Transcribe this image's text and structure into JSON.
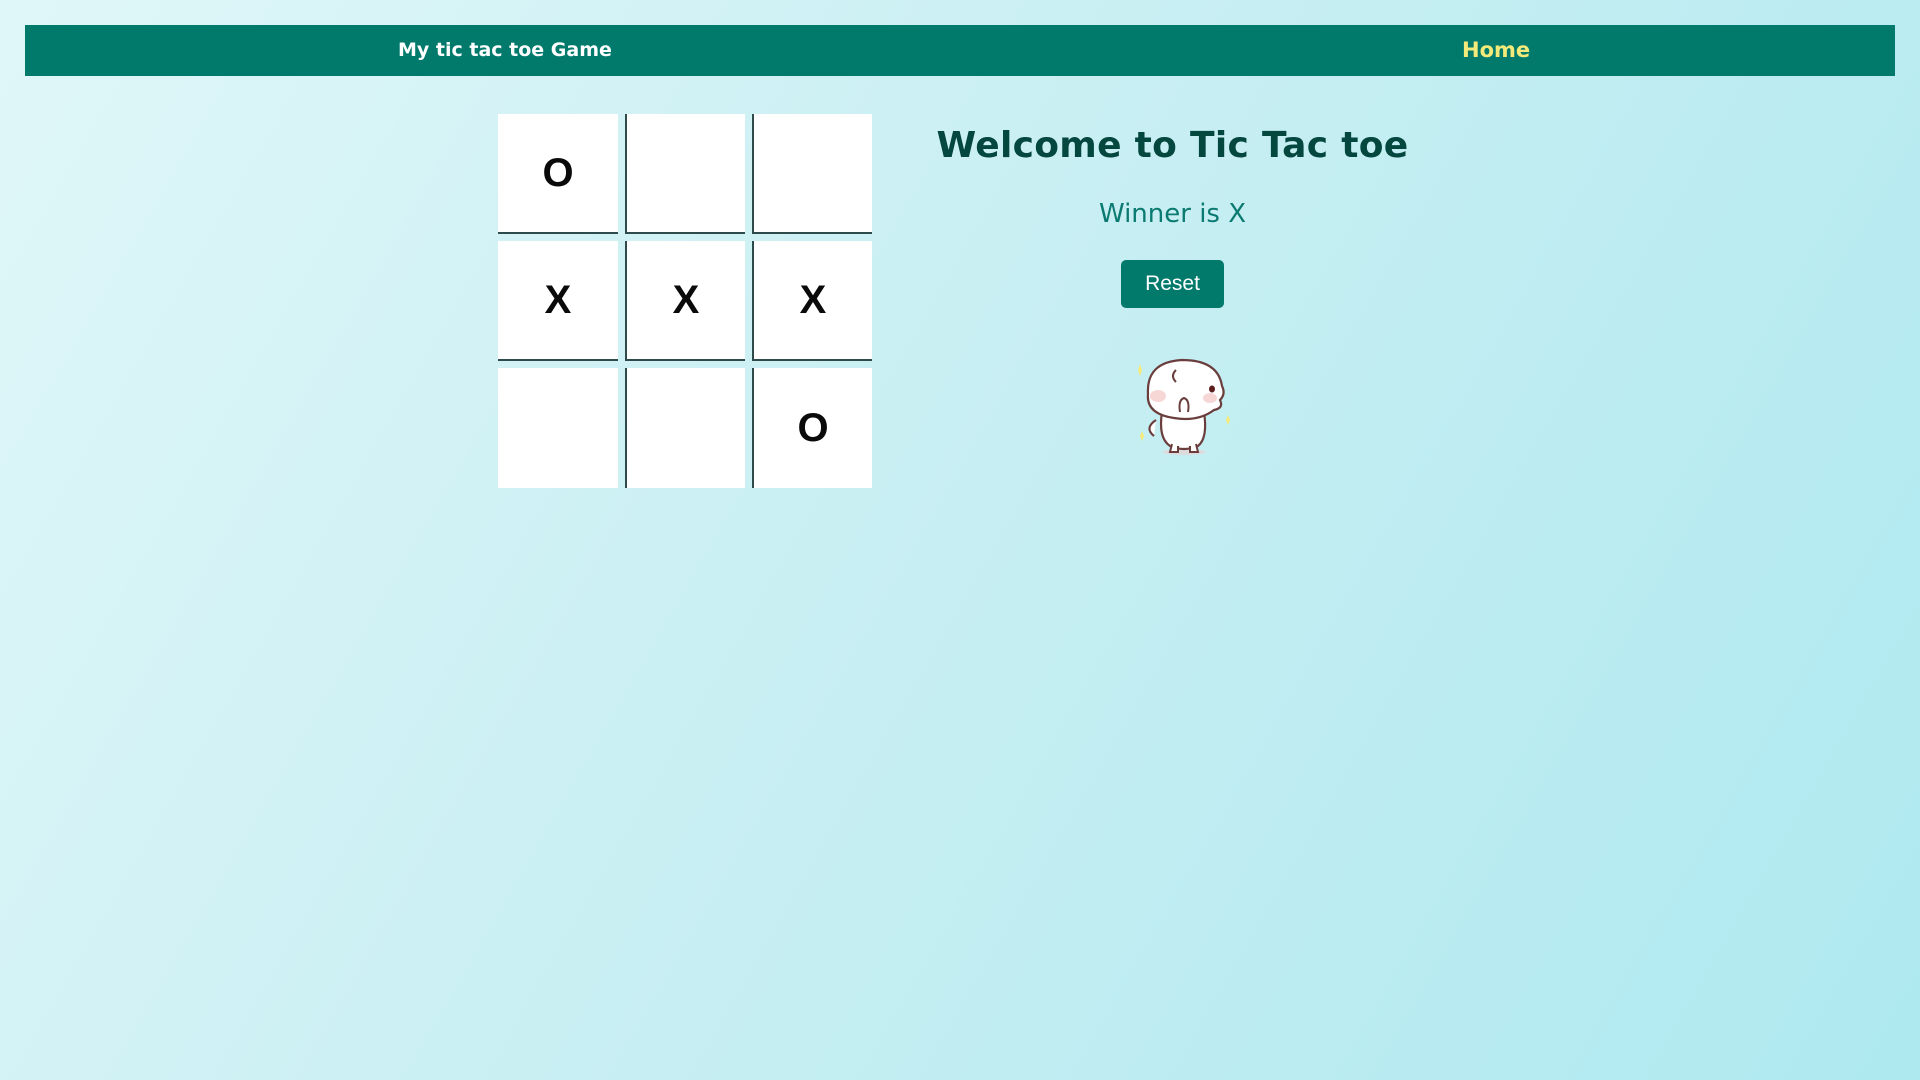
{
  "navbar": {
    "brand": "My tic tac toe Game",
    "home_link": "Home"
  },
  "board": {
    "cells": [
      "O",
      "",
      "",
      "X",
      "X",
      "X",
      "",
      "",
      "O"
    ]
  },
  "panel": {
    "title": "Welcome to Tic Tac toe",
    "status": "Winner is X",
    "reset_label": "Reset"
  },
  "mascot": {
    "icon": "dancing-cat-icon"
  },
  "colors": {
    "nav_background": "#017a6c",
    "home_link": "#f3ea7a",
    "title": "#04473f",
    "status": "#0b7a70",
    "button": "#017a6c"
  }
}
